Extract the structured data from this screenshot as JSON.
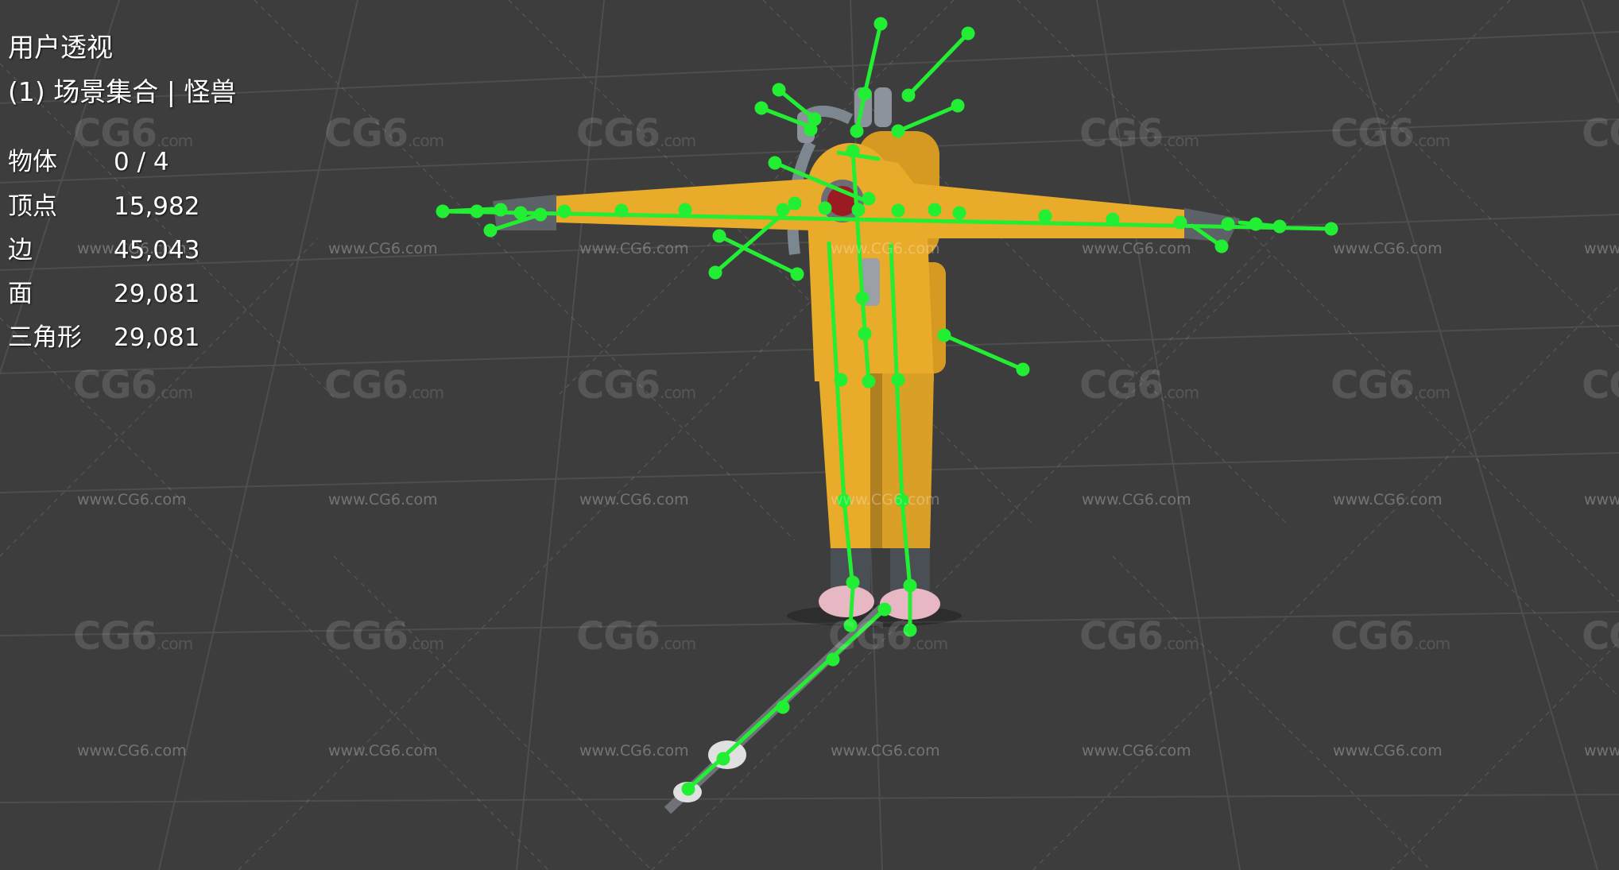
{
  "viewport": {
    "view_name": "用户透视",
    "collection_line": "(1) 场景集合 | 怪兽",
    "stats": [
      {
        "label": "物体",
        "value": "0 / 4"
      },
      {
        "label": "顶点",
        "value": "15,982"
      },
      {
        "label": "边",
        "value": "45,043"
      },
      {
        "label": "面",
        "value": "29,081"
      },
      {
        "label": "三角形",
        "value": "29,081"
      }
    ]
  },
  "watermark": {
    "logo_text": "CG6",
    "logo_suffix": ".com",
    "url_text": "www.CG6.com"
  },
  "colors": {
    "background": "#3d3d3d",
    "grid": "#4e4e4e",
    "suit": "#e8ab2a",
    "suit_shadow": "#c98e1c",
    "bones": "#22ee33",
    "boots": "#e8b7c4",
    "dark_metal": "#4a4f55",
    "visor": "#9c1b22"
  }
}
